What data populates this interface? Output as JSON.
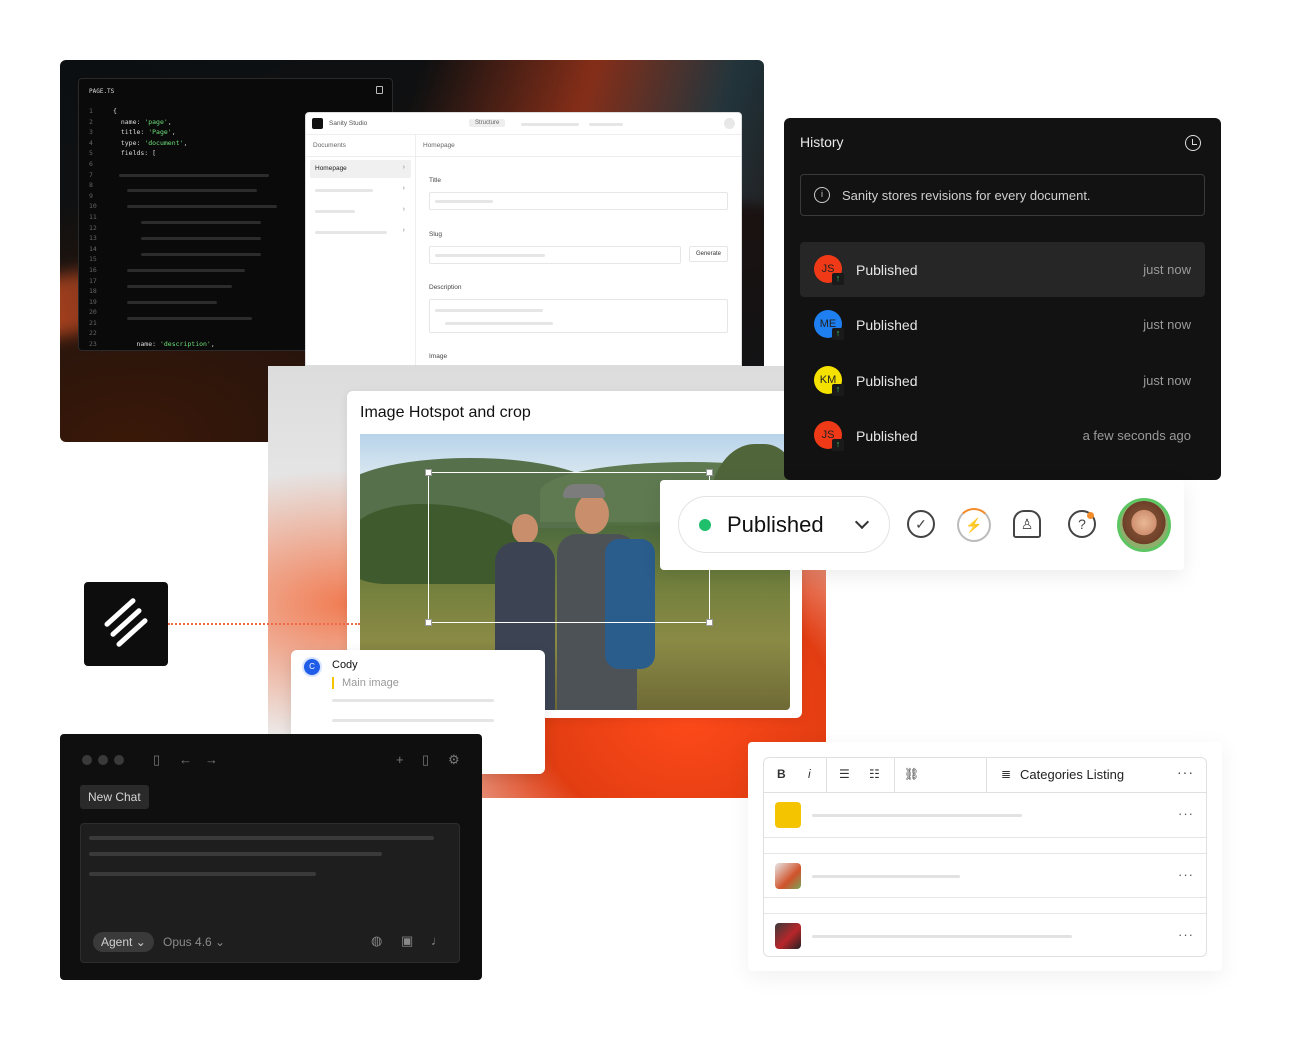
{
  "code_editor": {
    "file_name": "PAGE.TS",
    "lines": [
      {
        "n": "1",
        "text": "{"
      },
      {
        "n": "2",
        "text": "  name: ",
        "str": "'page'",
        "tail": ","
      },
      {
        "n": "3",
        "text": "  title: ",
        "str": "'Page'",
        "tail": ","
      },
      {
        "n": "4",
        "text": "  type: ",
        "str": "'document'",
        "tail": ","
      },
      {
        "n": "5",
        "text": "  fields: ["
      },
      {
        "n": "6",
        "text": ""
      },
      {
        "n": "7",
        "text": ""
      },
      {
        "n": "8",
        "text": ""
      },
      {
        "n": "9",
        "text": ""
      },
      {
        "n": "10",
        "text": ""
      },
      {
        "n": "11",
        "text": ""
      },
      {
        "n": "12",
        "text": ""
      },
      {
        "n": "13",
        "text": ""
      },
      {
        "n": "14",
        "text": ""
      },
      {
        "n": "15",
        "text": ""
      },
      {
        "n": "16",
        "text": ""
      },
      {
        "n": "17",
        "text": ""
      },
      {
        "n": "18",
        "text": ""
      },
      {
        "n": "19",
        "text": ""
      },
      {
        "n": "20",
        "text": ""
      },
      {
        "n": "21",
        "text": ""
      },
      {
        "n": "22",
        "text": ""
      },
      {
        "n": "23",
        "text": "      name: ",
        "str": "'description'",
        "tail": ","
      }
    ]
  },
  "studio": {
    "app_name": "Sanity Studio",
    "structure_tab": "Structure",
    "documents_header": "Documents",
    "selected_doc": "Homepage",
    "form_header": "Homepage",
    "fields": {
      "title": "Title",
      "slug": "Slug",
      "generate": "Generate",
      "description": "Description",
      "image": "Image"
    }
  },
  "image_card": {
    "title": "Image Hotspot and crop"
  },
  "comment": {
    "avatar_initial": "C",
    "author": "Cody",
    "quote": "Main image"
  },
  "history": {
    "title": "History",
    "info": "Sanity stores revisions for every document.",
    "rows": [
      {
        "initials": "JS",
        "label": "Published",
        "time": "just now",
        "color": "#f03a17"
      },
      {
        "initials": "ME",
        "label": "Published",
        "time": "just now",
        "color": "#1e7ff0"
      },
      {
        "initials": "KM",
        "label": "Published",
        "time": "just now",
        "color": "#f5e100"
      },
      {
        "initials": "JS",
        "label": "Published",
        "time": "a few seconds ago",
        "color": "#f03a17"
      }
    ]
  },
  "publish_bar": {
    "status": "Published",
    "status_color": "#1fbf6b"
  },
  "chat": {
    "new_chat": "New Chat",
    "agent": "Agent",
    "model": "Opus 4.6"
  },
  "categories": {
    "bold": "B",
    "italic": "i",
    "title": "Categories Listing"
  }
}
